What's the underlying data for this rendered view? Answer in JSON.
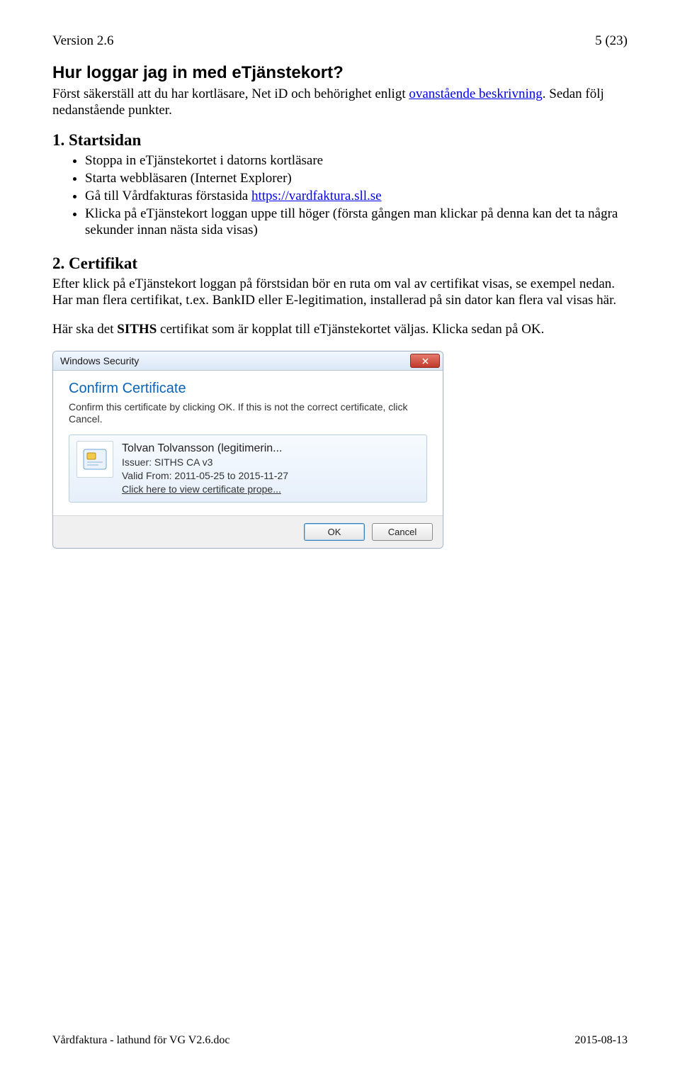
{
  "header": {
    "version": "Version 2.6",
    "page": "5 (23)"
  },
  "title": "Hur loggar jag in med eTjänstekort?",
  "intro": {
    "t1": "Först säkerställ att du har kortläsare, Net iD och behörighet enligt ",
    "link": "ovanstående beskrivning",
    "t2": ". Sedan följ nedanstående punkter."
  },
  "sec1": {
    "head": "1. Startsidan",
    "b1": "Stoppa in eTjänstekortet i datorns kortläsare",
    "b2": "Starta webbläsaren (Internet Explorer)",
    "b3a": "Gå till Vårdfakturas förstasida ",
    "b3link": "https://vardfaktura.sll.se",
    "b4": "Klicka på eTjänstekort loggan uppe till höger (första gången man klickar på denna kan det ta några sekunder innan nästa sida visas)"
  },
  "sec2": {
    "head": "2. Certifikat",
    "p1": "Efter klick på eTjänstekort loggan på förstsidan bör en ruta om val av certifikat visas, se exempel nedan. Har man flera certifikat, t.ex. BankID eller E-legitimation, installerad på sin dator kan flera val visas här.",
    "p2a": "Här ska det ",
    "p2b": "SITHS",
    "p2c": " certifikat som är kopplat till eTjänstekortet väljas. Klicka sedan på OK."
  },
  "dialog": {
    "title": "Windows Security",
    "heading": "Confirm Certificate",
    "message": "Confirm this certificate by clicking OK. If this is not the correct certificate, click Cancel.",
    "cert": {
      "name": "Tolvan Tolvansson (legitimerin...",
      "issuer": "Issuer: SITHS CA v3",
      "valid": "Valid From: 2011-05-25 to 2015-11-27",
      "view": "Click here to view certificate prope..."
    },
    "ok": "OK",
    "cancel": "Cancel"
  },
  "footer": {
    "left": "Vårdfaktura - lathund för VG V2.6.doc",
    "right": "2015-08-13"
  }
}
